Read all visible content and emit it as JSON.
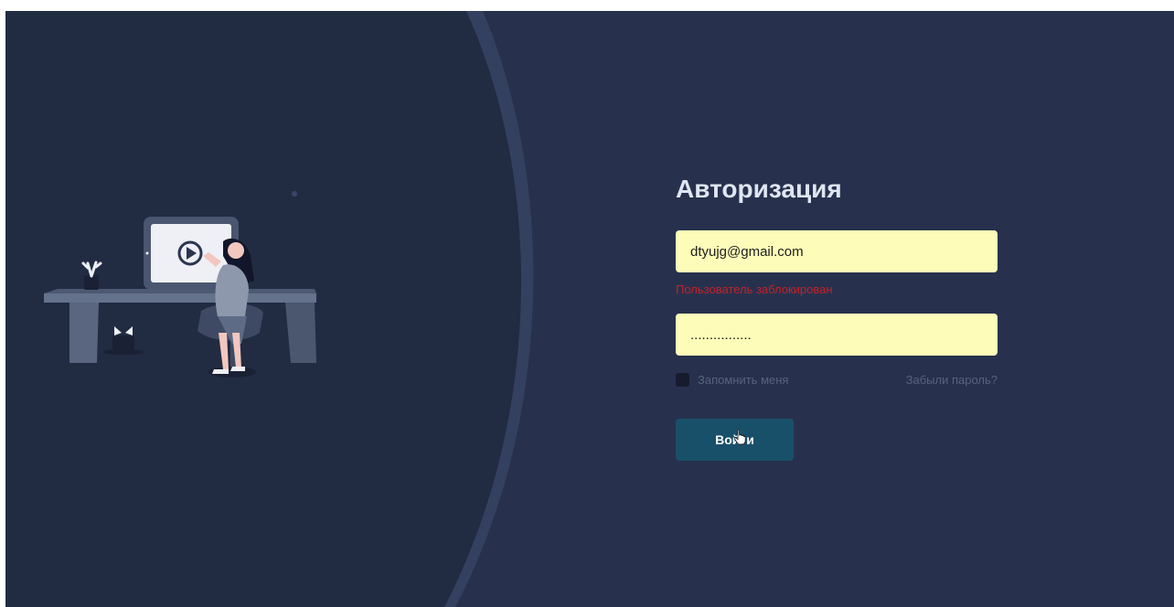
{
  "auth": {
    "title": "Авторизация",
    "email_value": "dtyujg@gmail.com",
    "email_error": "Пользователь заблокирован",
    "password_value": "................",
    "remember_label": "Запомнить меня",
    "forgot_label": "Забыли пароль?",
    "submit_label": "Войти"
  },
  "colors": {
    "background": "#27314d",
    "left_panel": "#212b42",
    "input_bg": "#fdfdb9",
    "error": "#c0232b",
    "button": "#195069"
  },
  "icons": {
    "illustration": "person-at-desk-with-monitor-illustration",
    "play": "play-icon",
    "cursor": "hand-cursor-icon"
  }
}
